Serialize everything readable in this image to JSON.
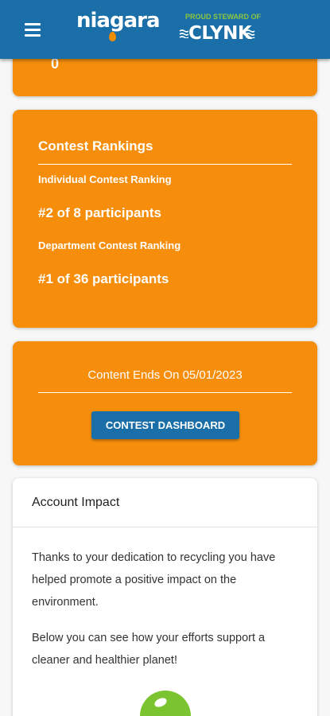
{
  "header": {
    "brand": "niagara",
    "steward_tagline": "PROUD STEWARD OF",
    "steward_name": "CLYNK"
  },
  "top_card": {
    "partial_value": "0"
  },
  "rankings": {
    "title": "Contest Rankings",
    "individual_label": "Individual Contest Ranking",
    "individual_value": "#2 of 8 participants",
    "department_label": "Department Contest Ranking",
    "department_value": "#1 of 36 participants"
  },
  "contest": {
    "ends_text": "Content Ends On 05/01/2023",
    "dashboard_button": "CONTEST DASHBOARD"
  },
  "impact": {
    "title": "Account Impact",
    "paragraph1": "Thanks to your dedication to recycling you have helped promote a positive impact on the environment.",
    "paragraph2": "Below you can see how your efforts support a cleaner and healthier planet!",
    "icon": "globe-icon"
  },
  "colors": {
    "header_blue": "#1b6fa8",
    "card_orange": "#f68e0c",
    "clynk_green": "#8dc63f"
  }
}
